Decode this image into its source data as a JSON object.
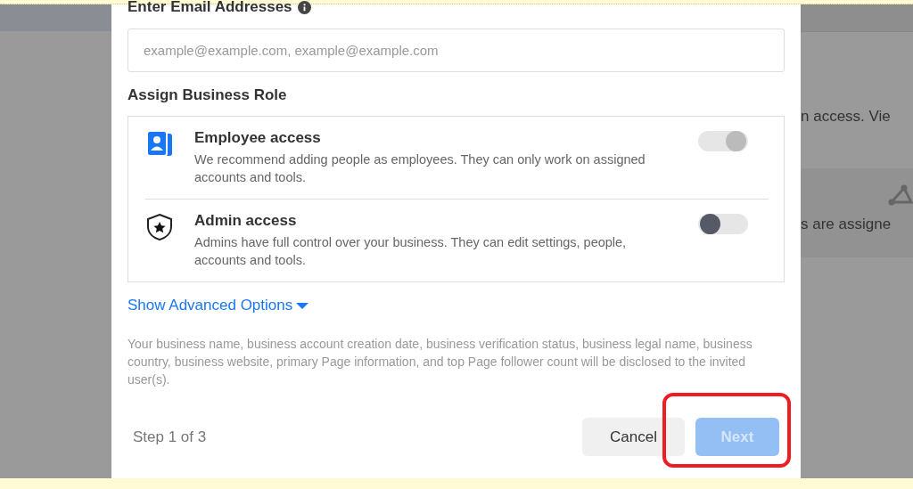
{
  "background": {
    "texts": [
      "n access. Vie",
      "s are assigne"
    ]
  },
  "dialog": {
    "email_label": "Enter Email Addresses",
    "email_placeholder": "example@example.com, example@example.com",
    "role_heading": "Assign Business Role",
    "roles": [
      {
        "kind": "employee",
        "title": "Employee access",
        "description": "We recommend adding people as employees. They can only work on assigned accounts and tools.",
        "on": true,
        "disabled": true
      },
      {
        "kind": "admin",
        "title": "Admin access",
        "description": "Admins have full control over your business. They can edit settings, people, accounts and tools.",
        "on": false,
        "disabled": false
      }
    ],
    "advanced_link": "Show Advanced Options",
    "disclosure": "Your business name, business account creation date, business verification status, business legal name, business country, business website, primary Page information, and top Page follower count will be disclosed to the invited user(s).",
    "step": "Step 1 of 3",
    "buttons": [
      {
        "label": "Cancel",
        "kind": "secondary"
      },
      {
        "label": "Next",
        "kind": "primary",
        "disabled": true,
        "highlighted": true
      }
    ]
  }
}
